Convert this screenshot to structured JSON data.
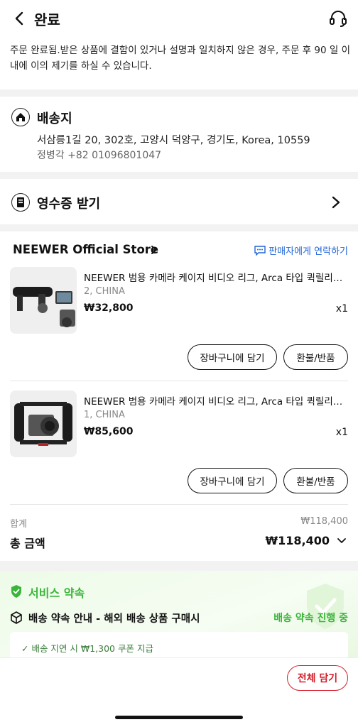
{
  "header": {
    "title": "완료"
  },
  "notice": "주문 완료됨.받은 상품에 결함이 있거나 설명과 일치하지 않은 경우, 주문 후 90 일 이내에 이의 제기를 하실 수 있습니다.",
  "shipping": {
    "title": "배송지",
    "address": "서삼릉1길 20, 302호, 고양시 덕양구, 경기도, Korea, 10559",
    "contact": "정병각 +82 01096801047"
  },
  "receipt": {
    "label": "영수증 받기"
  },
  "store": {
    "name": "NEEWER Official Store",
    "contact_label": "판매자에게 연락하기"
  },
  "products": [
    {
      "name": "NEEWER 범용 카메라 케이지 비디오 리그, Arca 타입 퀵릴리즈 핸들",
      "variant": "2, CHINA",
      "price": "₩32,800",
      "qty": "x1",
      "cart_label": "장바구니에 담기",
      "refund_label": "환불/반품"
    },
    {
      "name": "NEEWER 범용 카메라 케이지 비디오 리그, Arca 타입 퀵릴리즈 핸들",
      "variant": "1, CHINA",
      "price": "₩85,600",
      "qty": "x1",
      "cart_label": "장바구니에 담기",
      "refund_label": "환불/반품"
    }
  ],
  "summary": {
    "subtotal_label": "합계",
    "subtotal_value": "₩118,400",
    "total_label": "총 금액",
    "total_value": "₩118,400"
  },
  "service": {
    "title": "서비스 약속",
    "row_label": "배송 약속 안내 - 해외 배송 상품 구매시",
    "row_status": "배송 약속 진행 중",
    "bullet": "✓ 배송 지연 시 ₩1,300 쿠폰 지급"
  },
  "bottom": {
    "add_all_label": "전체 담기"
  },
  "colors": {
    "accent_red": "#d61f2c",
    "link_blue": "#1f63d6",
    "service_green": "#3cb43c"
  }
}
